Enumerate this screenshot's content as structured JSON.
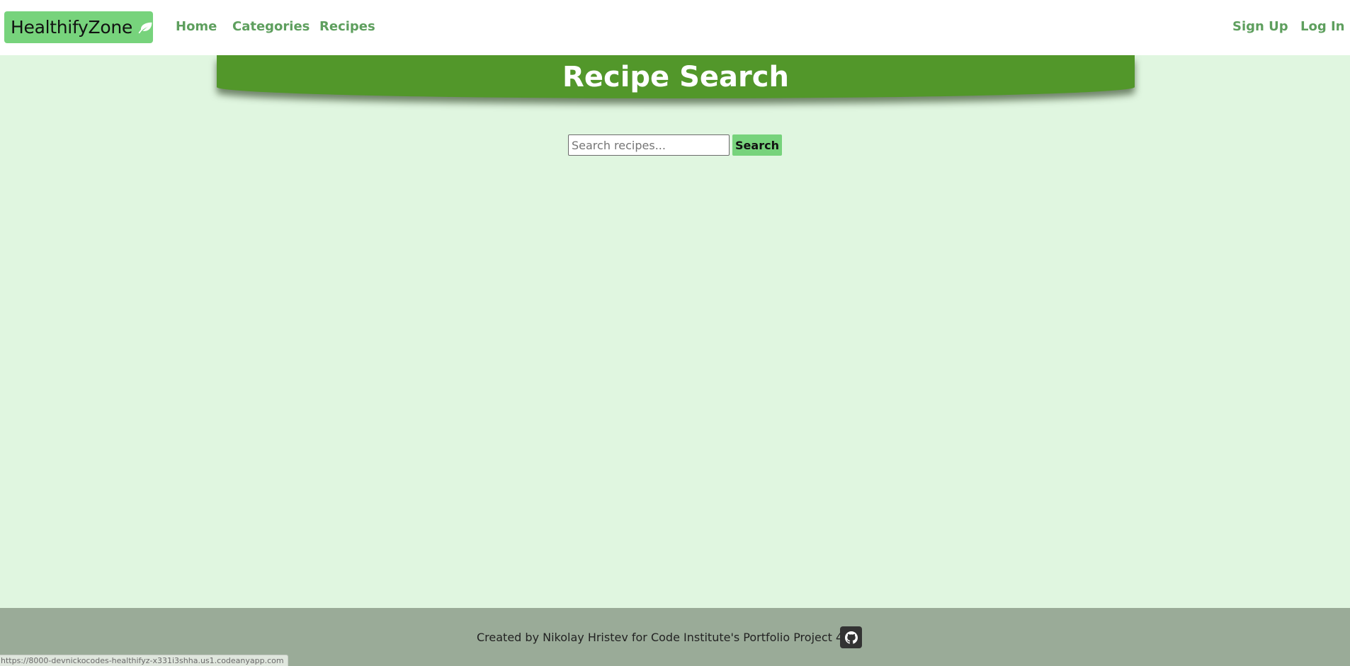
{
  "navbar": {
    "brand": {
      "label": "HealthifyZone",
      "icon": "leaf-icon"
    },
    "links": [
      {
        "label": "Home"
      },
      {
        "label": "Categories"
      },
      {
        "label": "Recipes"
      }
    ],
    "auth_links": [
      {
        "label": "Sign Up"
      },
      {
        "label": "Log In"
      }
    ]
  },
  "header": {
    "title": "Recipe Search"
  },
  "search": {
    "placeholder": "Search recipes...",
    "value": "",
    "button_label": "Search"
  },
  "footer": {
    "credit": "Created by Nikolay Hristev for Code Institute's Portfolio Project 4",
    "github_icon": "github-icon"
  },
  "status_bar": {
    "url": "https://8000-devnickocodes-healthifyz-x331i3shha.us1.codeanyapp.com"
  },
  "colors": {
    "page_background": "#e0f6e0",
    "brand_background": "#77d37c",
    "nav_link": "#5e9f5e",
    "banner": "#52972a",
    "footer": "#9aab98",
    "search_button": "#77d37c"
  }
}
